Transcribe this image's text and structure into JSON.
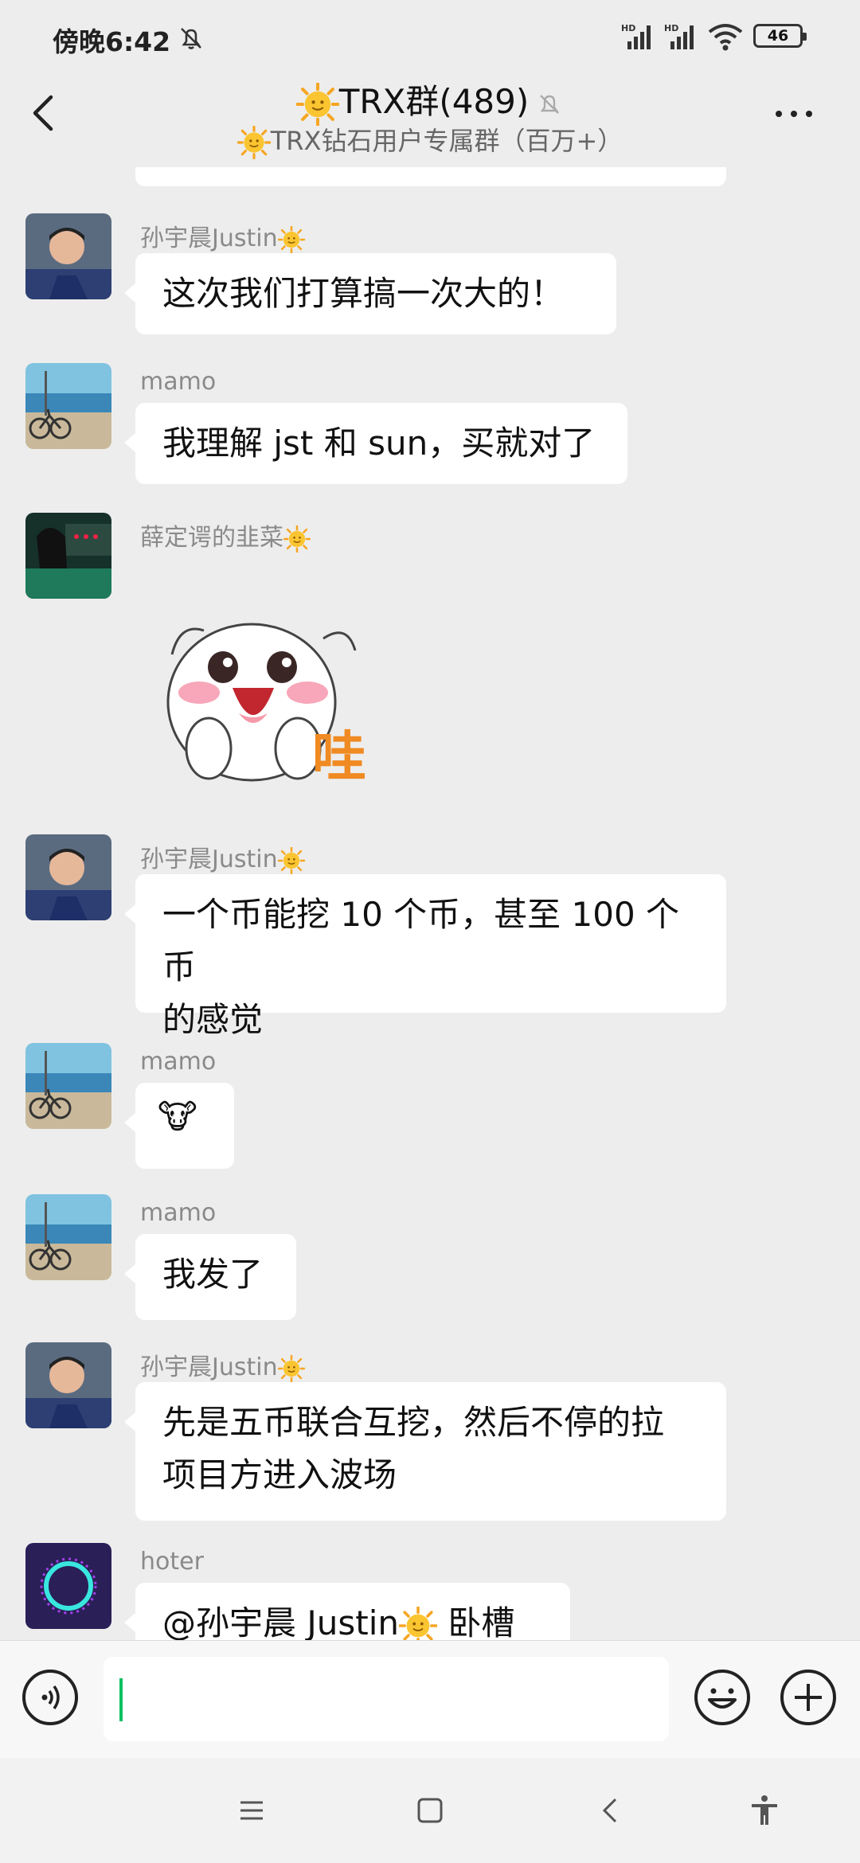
{
  "status_bar": {
    "time": "傍晚6:42",
    "signal_label_1": "HD",
    "signal_label_2": "HD",
    "battery": "46"
  },
  "header": {
    "title": "TRX群(489)",
    "subtitle": "TRX钻石用户专属群（百万+）"
  },
  "messages": [
    {
      "sender": "孙宇晨Justin",
      "text": "这次我们打算搞一次大的！"
    },
    {
      "sender": "mamo",
      "text": "我理解 jst 和 sun，买就对了"
    },
    {
      "sender": "薛定谔的韭菜",
      "sticker_text": "哇"
    },
    {
      "sender": "孙宇晨Justin",
      "text_line1": "一个币能挖 10 个币，甚至 100 个币",
      "text_line2": "的感觉"
    },
    {
      "sender": "mamo",
      "emoji": "🐮"
    },
    {
      "sender": "mamo",
      "text": "我发了"
    },
    {
      "sender": "孙宇晨Justin",
      "text_line1": "先是五币联合互挖，然后不停的拉",
      "text_line2": "项目方进入波场"
    },
    {
      "sender": "hoter",
      "text_prefix": "@孙宇晨 Justin",
      "text_suffix": " 卧槽"
    }
  ],
  "input": {
    "value": "",
    "placeholder": ""
  },
  "colors": {
    "accent": "#07c160",
    "background": "#ededed",
    "bubble": "#ffffff"
  }
}
